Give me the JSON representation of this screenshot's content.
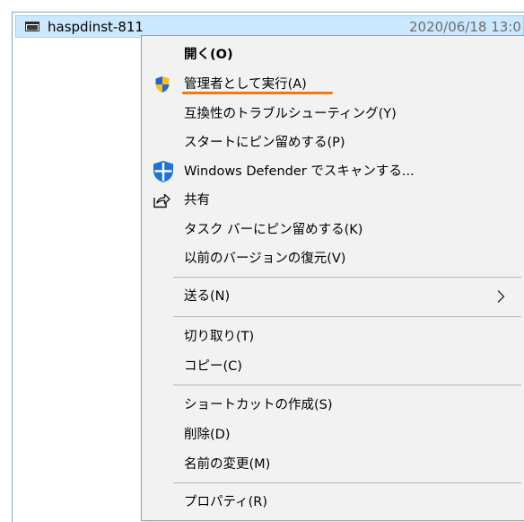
{
  "file": {
    "name": "haspdinst-811",
    "date": "2020/06/18 13:0",
    "icon": "application-window-icon"
  },
  "menu": {
    "items": [
      {
        "label": "開く(O)",
        "bold": true
      },
      {
        "label": "管理者として実行(A)",
        "icon": "uac-shield-icon",
        "highlighted": true
      },
      {
        "label": "互換性のトラブルシューティング(Y)"
      },
      {
        "label": "スタートにピン留めする(P)"
      },
      {
        "label": "Windows Defender でスキャンする...",
        "icon": "windows-defender-icon"
      },
      {
        "label": "共有",
        "icon": "share-icon"
      },
      {
        "label": "タスク バーにピン留めする(K)"
      },
      {
        "label": "以前のバージョンの復元(V)"
      },
      {
        "label": "送る(N)",
        "submenu": true
      },
      {
        "label": "切り取り(T)"
      },
      {
        "label": "コピー(C)"
      },
      {
        "label": "ショートカットの作成(S)"
      },
      {
        "label": "削除(D)"
      },
      {
        "label": "名前の変更(M)"
      },
      {
        "label": "プロパティ(R)"
      }
    ]
  },
  "colors": {
    "selection_bg": "#cce8ff",
    "menu_bg": "#f2f2f2",
    "highlight_underline": "#f07a12",
    "shield_blue": "#2b65c8",
    "shield_yellow": "#f7c321",
    "defender_blue": "#1e73d6"
  }
}
